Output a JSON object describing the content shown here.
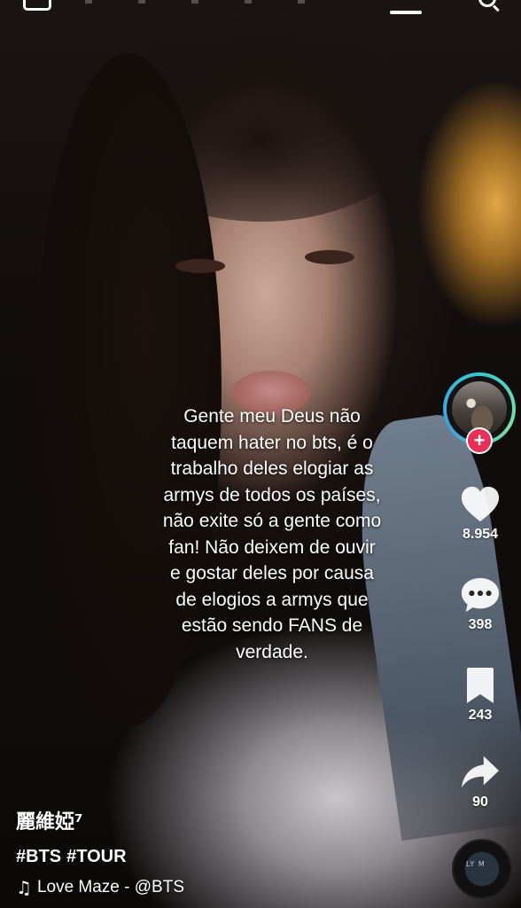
{
  "caption": {
    "lines": [
      "Gente meu Deus não",
      "taquem hater no bts, é o",
      "trabalho deles elogiar as",
      "armys de todos os países,",
      "não exite só a gente como",
      "fan! Não deixem de ouvir",
      "e gostar deles por causa",
      "de elogios a armys que",
      "estão sendo FANS de",
      "verdade."
    ]
  },
  "actions": {
    "likes": "8.954",
    "comments": "398",
    "saves": "243",
    "shares": "90"
  },
  "follow": {
    "plus": "+"
  },
  "info": {
    "username": "麗維婭⁷",
    "hashtags": [
      "#BTS",
      "#TOUR"
    ],
    "music": "Love Maze - @BTS"
  },
  "disc": {
    "label": "LY M"
  },
  "colors": {
    "follow_plus": "#ea2e55",
    "avatar_ring": "#37c9d6",
    "text": "#ffffff"
  },
  "icons": [
    "back-icon",
    "live-indicator-icon",
    "search-icon",
    "heart-icon",
    "comment-icon",
    "bookmark-icon",
    "share-icon",
    "music-note-icon",
    "music-disc-icon"
  ]
}
